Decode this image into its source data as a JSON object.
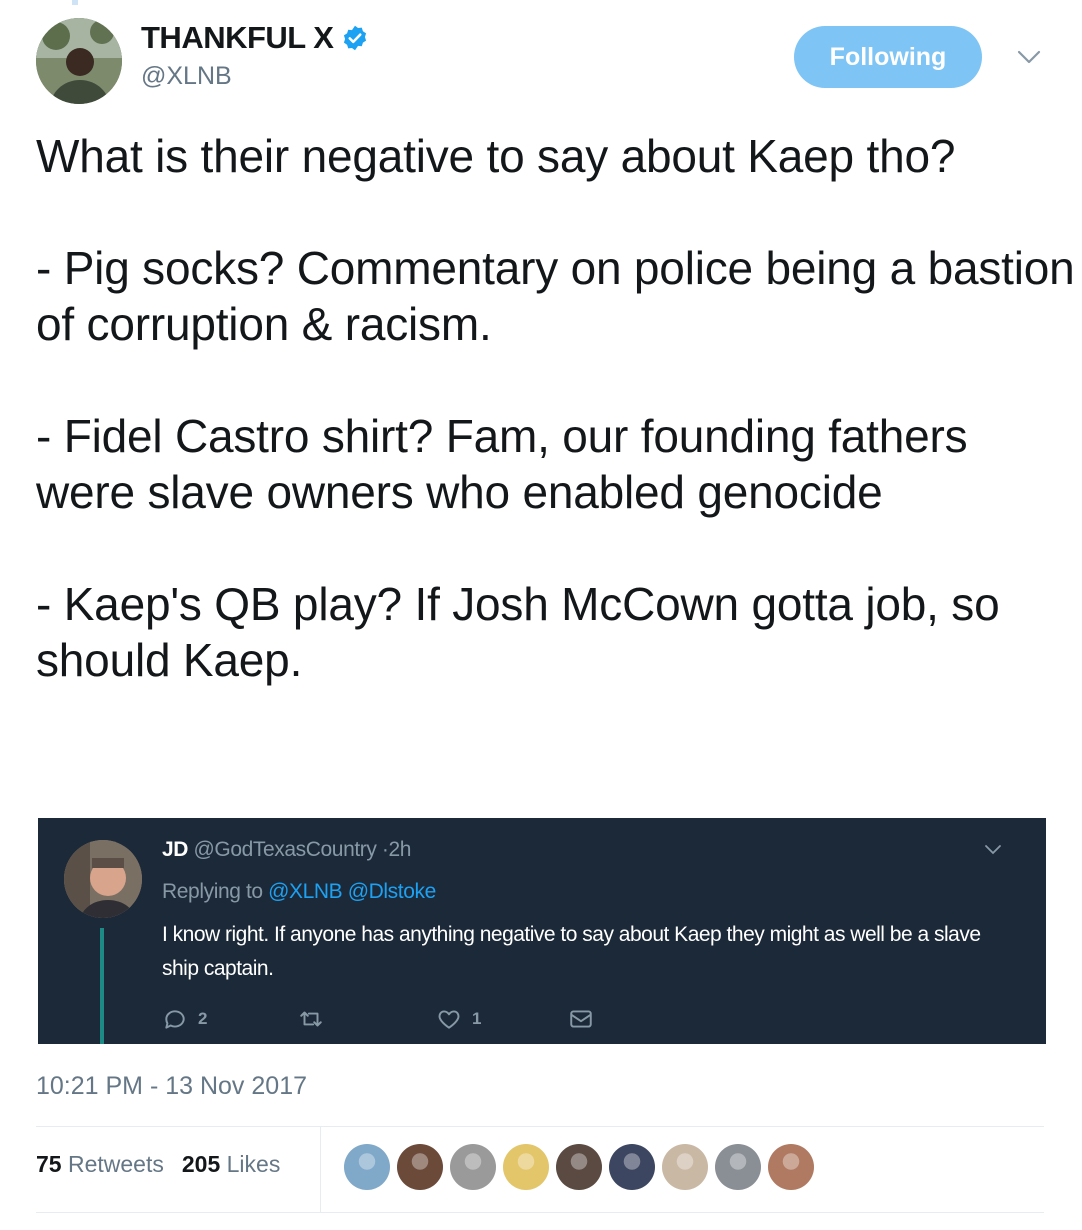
{
  "author": {
    "display_name": "THANKFUL X",
    "handle": "@XLNB",
    "verified": true,
    "avatar_icon": "user-avatar-photo"
  },
  "follow_button": {
    "label": "Following",
    "color": "#7ec4f5"
  },
  "tweet": {
    "text": "What is their negative to say about Kaep tho?\n\n- Pig socks? Commentary on police being a bastion of corruption & racism.\n\n- Fidel Castro shirt? Fam, our founding fathers were slave owners who enabled genocide\n\n- Kaep's QB play? If Josh McCown gotta job, so should Kaep.",
    "timestamp": "10:21 PM - 13 Nov 2017"
  },
  "embedded_tweet": {
    "name": "JD",
    "handle": "@GodTexasCountry",
    "time": "·2h",
    "replying_label": "Replying to",
    "mentions": [
      "@XLNB",
      "@Dlstoke"
    ],
    "text": "I know right. If anyone has anything negative to say about Kaep they might as well be a slave ship captain.",
    "replies": "2",
    "retweets": "",
    "likes": "1",
    "background": "#1c2938"
  },
  "stats": {
    "retweets_count": "75",
    "retweets_label": "Retweets",
    "likes_count": "205",
    "likes_label": "Likes"
  },
  "likers": [
    {
      "name": "liker-avatar-1",
      "color": "#7fa8c9"
    },
    {
      "name": "liker-avatar-2",
      "color": "#6b4a3a"
    },
    {
      "name": "liker-avatar-3",
      "color": "#9a9a9a"
    },
    {
      "name": "liker-avatar-4",
      "color": "#e3c56a"
    },
    {
      "name": "liker-avatar-5",
      "color": "#5a4a42"
    },
    {
      "name": "liker-avatar-6",
      "color": "#3c4660"
    },
    {
      "name": "liker-avatar-7",
      "color": "#c9b8a4"
    },
    {
      "name": "liker-avatar-8",
      "color": "#8a8f96"
    },
    {
      "name": "liker-avatar-9",
      "color": "#b07a62"
    }
  ]
}
